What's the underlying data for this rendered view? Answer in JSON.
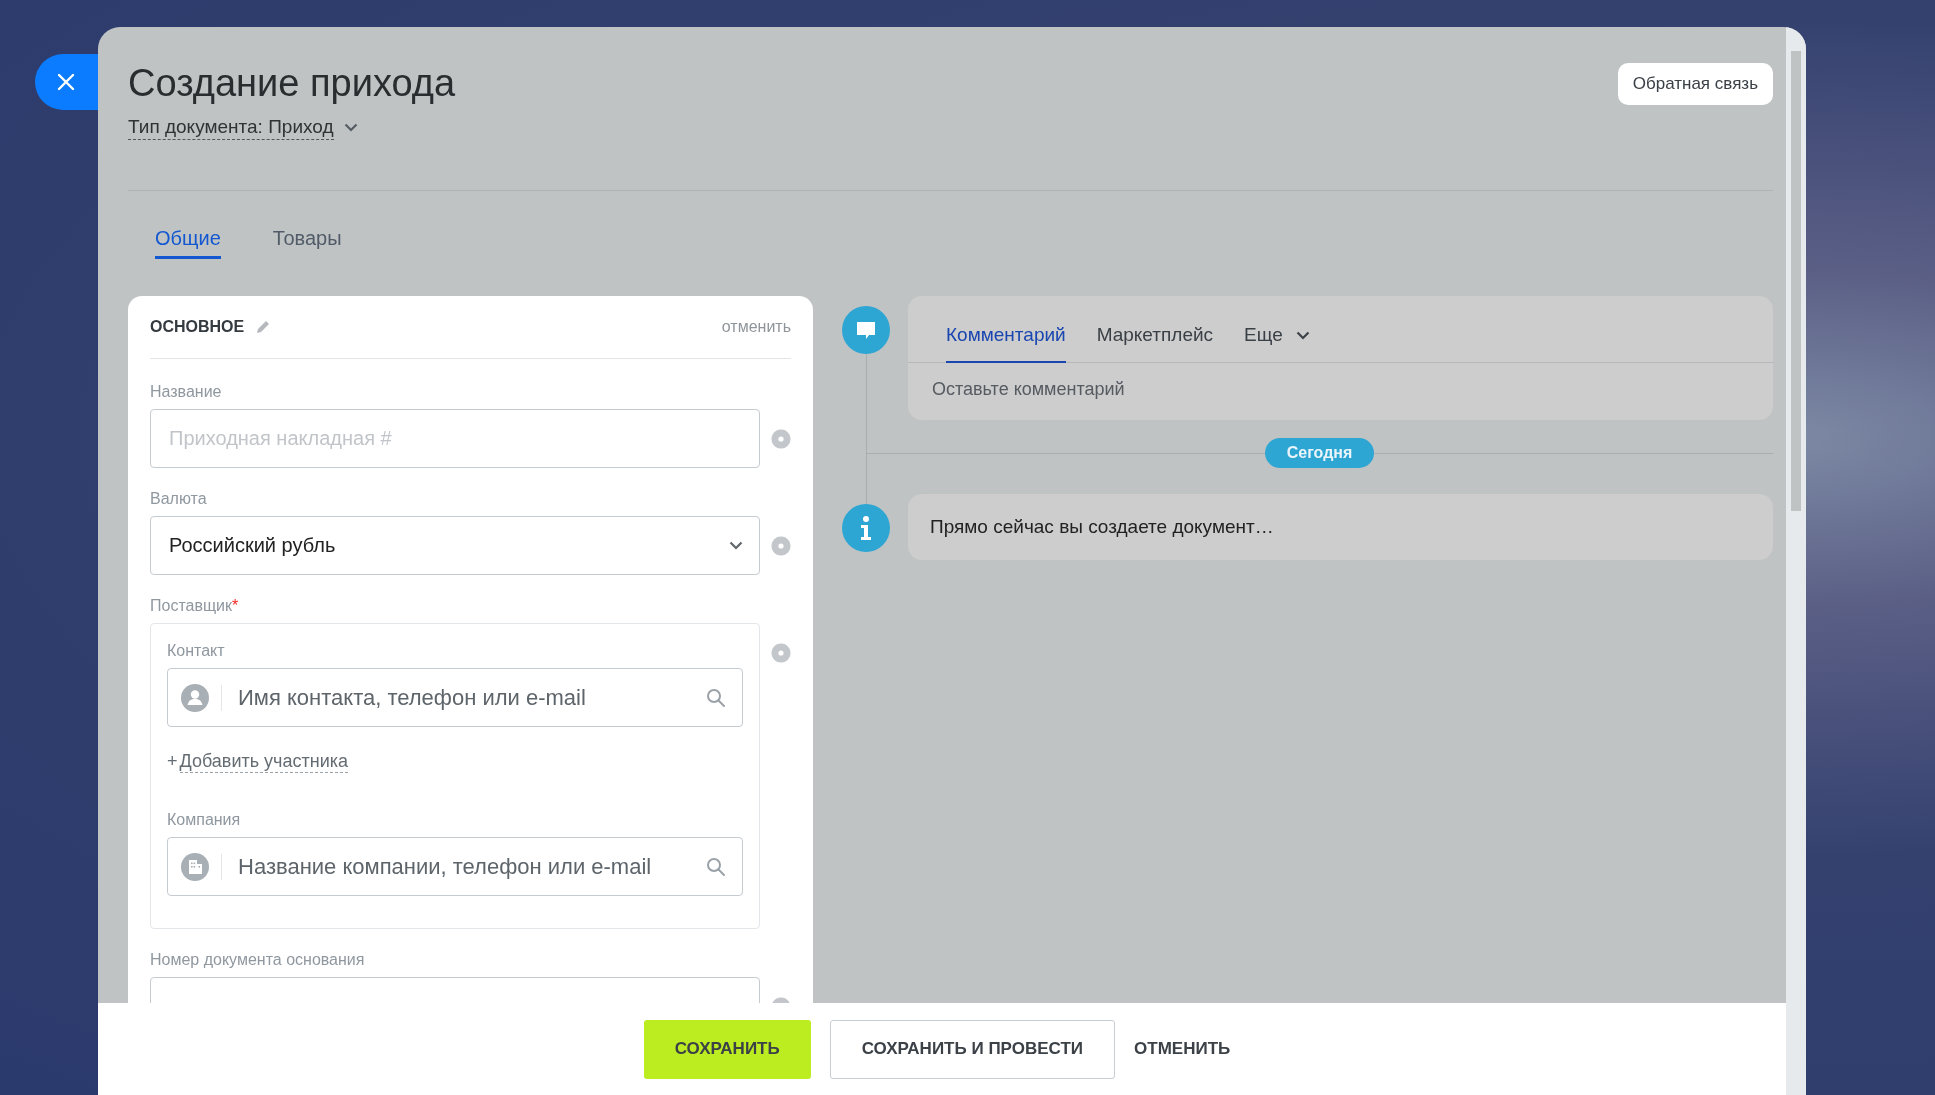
{
  "header": {
    "title": "Создание прихода",
    "document_type": "Тип документа: Приход",
    "feedback_button": "Обратная связь"
  },
  "tabs": [
    {
      "label": "Общие",
      "selected": true
    },
    {
      "label": "Товары",
      "selected": false
    }
  ],
  "section": {
    "title": "ОСНОВНОЕ",
    "cancel_link": "отменить",
    "fields": [
      {
        "kind": "text",
        "label": "Название",
        "placeholder": "Приходная накладная #"
      },
      {
        "kind": "select",
        "label": "Валюта",
        "value": "Российский рубль"
      },
      {
        "kind": "client",
        "label": "Поставщик",
        "required_mark": "*",
        "groups": [
          {
            "kind": "contact",
            "label": "Контакт",
            "placeholder": "Имя контакта, телефон или e-mail",
            "add_mark": "+",
            "add_link": "Добавить участника"
          },
          {
            "kind": "company",
            "label": "Компания",
            "placeholder": "Название компании, телефон или e-mail"
          }
        ]
      },
      {
        "kind": "text",
        "label": "Номер документа основания"
      }
    ]
  },
  "timeline": {
    "composer": {
      "tabs": [
        {
          "label": "Комментарий",
          "selected": true,
          "dropdown": false
        },
        {
          "label": "Маркетплейс",
          "selected": false,
          "dropdown": false
        },
        {
          "label": "Еще",
          "selected": false,
          "dropdown": true
        }
      ],
      "placeholder": "Оставьте комментарий"
    },
    "date_badge": "Сегодня",
    "items": [
      {
        "kind": "info",
        "text": "Прямо сейчас вы создаете документ…"
      }
    ]
  },
  "footer": {
    "buttons": [
      {
        "kind": "primary",
        "label": "СОХРАНИТЬ"
      },
      {
        "kind": "secondary",
        "label": "СОХРАНИТЬ И ПРОВЕСТИ"
      },
      {
        "kind": "link",
        "label": "ОТМЕНИТЬ"
      }
    ]
  }
}
